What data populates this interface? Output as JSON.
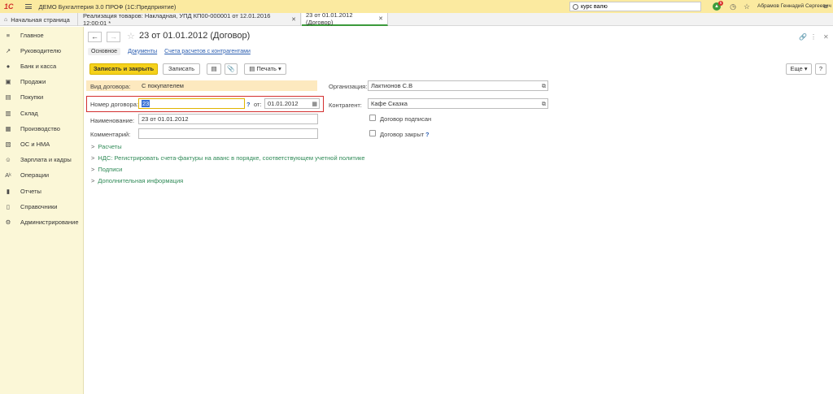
{
  "titlebar": {
    "logo": "1С",
    "app_title": "ДЕМО Бухгалтерия 3.0 ПРОФ  (1С:Предприятие)",
    "search_value": "курс валю",
    "notification_count": "5",
    "user": "Абрамов Геннадий Сергеевич"
  },
  "tabs": {
    "home": "Начальная страница",
    "items": [
      {
        "label": "Реализация товаров: Накладная, УПД КП00-000001 от 12.01.2016 12:00:01 *"
      },
      {
        "label": "23 от 01.01.2012 (Договор)"
      }
    ]
  },
  "sidebar": {
    "items": [
      {
        "icon": "≡",
        "label": "Главное"
      },
      {
        "icon": "↗",
        "label": "Руководителю"
      },
      {
        "icon": "●",
        "label": "Банк и касса"
      },
      {
        "icon": "▣",
        "label": "Продажи"
      },
      {
        "icon": "▤",
        "label": "Покупки"
      },
      {
        "icon": "▥",
        "label": "Склад"
      },
      {
        "icon": "▦",
        "label": "Производство"
      },
      {
        "icon": "▧",
        "label": "ОС и НМА"
      },
      {
        "icon": "☺",
        "label": "Зарплата и кадры"
      },
      {
        "icon": "Аᵏ",
        "label": "Операции"
      },
      {
        "icon": "▮",
        "label": "Отчеты"
      },
      {
        "icon": "▯",
        "label": "Справочники"
      },
      {
        "icon": "⚙",
        "label": "Администрирование"
      }
    ]
  },
  "document": {
    "title": "23 от 01.01.2012 (Договор)",
    "subtabs": [
      "Основное",
      "Документы",
      "Счета расчетов с контрагентами"
    ],
    "toolbar": {
      "save_close": "Записать и закрыть",
      "save": "Записать",
      "print": "Печать",
      "more": "Еще",
      "help": "?"
    },
    "fields": {
      "contract_type_label": "Вид договора:",
      "contract_type_value": "С покупателем",
      "contract_number_label": "Номер договора:",
      "contract_number_value": "23",
      "date_label": "от:",
      "date_value": "01.01.2012",
      "name_label": "Наименование:",
      "name_value": "23 от 01.01.2012",
      "comment_label": "Комментарий:",
      "comment_value": "",
      "org_label": "Организация:",
      "org_value": "Лактионов С.В",
      "contragent_label": "Контрагент:",
      "contragent_value": "Кафе Сказка",
      "signed_label": "Договор подписан",
      "closed_label": "Договор закрыт"
    },
    "groups": [
      "Расчеты",
      "НДС: Регистрировать счета-фактуры на аванс в порядке, соответствующем учетной политике",
      "Подписи",
      "Дополнительная информация"
    ]
  }
}
